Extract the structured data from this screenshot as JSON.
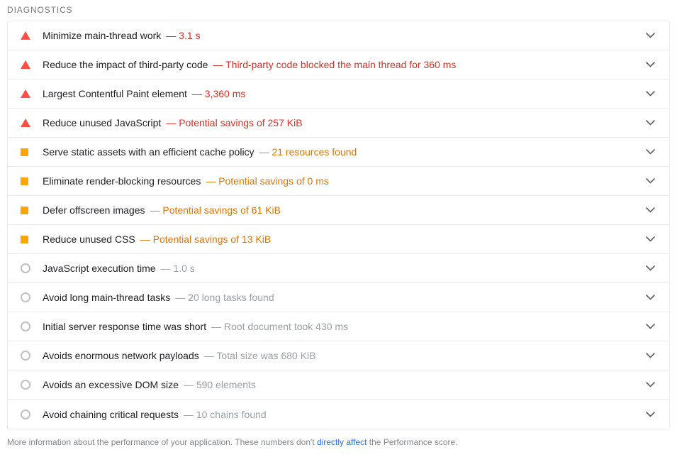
{
  "section": {
    "header": "DIAGNOSTICS"
  },
  "colors": {
    "fail": "#ff4e42",
    "fail_text": "#d93025",
    "average": "#ffa400",
    "average_text": "#e37400",
    "pass": "#bdc1c6",
    "pass_text": "#9aa0a6",
    "link": "#1a73e8",
    "title": "#202124",
    "border": "#ebebeb"
  },
  "audits": [
    {
      "severity": "fail",
      "icon": "warning-triangle-icon",
      "title": "Minimize main-thread work",
      "separator": "—",
      "value": "3.1 s",
      "expand_icon": "chevron-down-icon"
    },
    {
      "severity": "fail",
      "icon": "warning-triangle-icon",
      "title": "Reduce the impact of third-party code",
      "separator": "—",
      "value": "Third-party code blocked the main thread for 360 ms",
      "expand_icon": "chevron-down-icon"
    },
    {
      "severity": "fail",
      "icon": "warning-triangle-icon",
      "title": "Largest Contentful Paint element",
      "separator": "—",
      "value": "3,360 ms",
      "expand_icon": "chevron-down-icon"
    },
    {
      "severity": "fail",
      "icon": "warning-triangle-icon",
      "title": "Reduce unused JavaScript",
      "separator": "—",
      "value": "Potential savings of 257 KiB",
      "expand_icon": "chevron-down-icon"
    },
    {
      "severity": "average",
      "icon": "warning-square-icon",
      "title": "Serve static assets with an efficient cache policy",
      "separator": "—",
      "value": "21 resources found",
      "expand_icon": "chevron-down-icon"
    },
    {
      "severity": "average",
      "icon": "warning-square-icon",
      "title": "Eliminate render-blocking resources",
      "separator": "—",
      "value": "Potential savings of 0 ms",
      "expand_icon": "chevron-down-icon"
    },
    {
      "severity": "average",
      "icon": "warning-square-icon",
      "title": "Defer offscreen images",
      "separator": "—",
      "value": "Potential savings of 61 KiB",
      "expand_icon": "chevron-down-icon"
    },
    {
      "severity": "average",
      "icon": "warning-square-icon",
      "title": "Reduce unused CSS",
      "separator": "—",
      "value": "Potential savings of 13 KiB",
      "expand_icon": "chevron-down-icon"
    },
    {
      "severity": "pass",
      "icon": "info-circle-icon",
      "title": "JavaScript execution time",
      "separator": "—",
      "value": "1.0 s",
      "expand_icon": "chevron-down-icon"
    },
    {
      "severity": "pass",
      "icon": "info-circle-icon",
      "title": "Avoid long main-thread tasks",
      "separator": "—",
      "value": "20 long tasks found",
      "expand_icon": "chevron-down-icon"
    },
    {
      "severity": "pass",
      "icon": "info-circle-icon",
      "title": "Initial server response time was short",
      "separator": "—",
      "value": "Root document took 430 ms",
      "expand_icon": "chevron-down-icon"
    },
    {
      "severity": "pass",
      "icon": "info-circle-icon",
      "title": "Avoids enormous network payloads",
      "separator": "—",
      "value": "Total size was 680 KiB",
      "expand_icon": "chevron-down-icon"
    },
    {
      "severity": "pass",
      "icon": "info-circle-icon",
      "title": "Avoids an excessive DOM size",
      "separator": "—",
      "value": "590 elements",
      "expand_icon": "chevron-down-icon"
    },
    {
      "severity": "pass",
      "icon": "info-circle-icon",
      "title": "Avoid chaining critical requests",
      "separator": "—",
      "value": "10 chains found",
      "expand_icon": "chevron-down-icon"
    }
  ],
  "footer": {
    "text_before": "More information about the performance of your application. These numbers don't ",
    "link_text": "directly affect",
    "text_after": " the Performance score."
  }
}
